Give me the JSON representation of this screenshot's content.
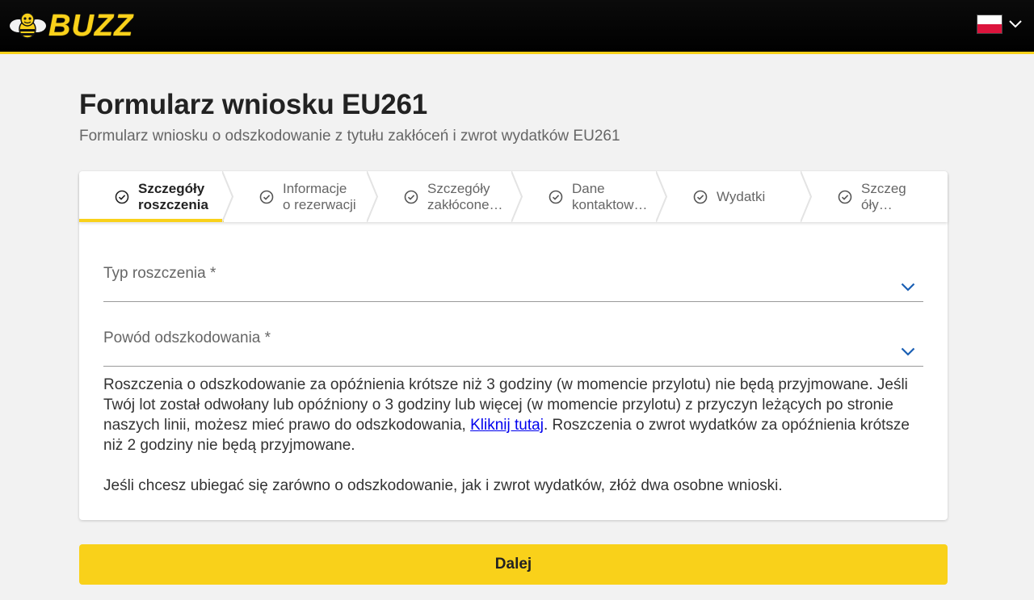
{
  "header": {
    "logo_text": "BUZZ",
    "language_flag": "poland-flag-icon",
    "brand_color": "#f9d11a"
  },
  "page": {
    "title": "Formularz wniosku EU261",
    "subtitle": "Formularz wniosku o odszkodowanie z tytułu zakłóceń i zwrot wydatków EU261"
  },
  "steps": [
    {
      "label": "Szczegóły\nroszczenia",
      "active": true
    },
    {
      "label": "Informacje\no rezerwacji",
      "active": false
    },
    {
      "label": "Szczegóły\nzakłócone…",
      "active": false
    },
    {
      "label": "Dane\nkontaktow…",
      "active": false
    },
    {
      "label": "Wydatki",
      "active": false
    },
    {
      "label": "Szczeg\nóły…",
      "active": false
    }
  ],
  "form": {
    "claim_type_label": "Typ roszczenia *",
    "compensation_reason_label": "Powód odszkodowania *"
  },
  "info": {
    "p1_before_link": "Roszczenia o odszkodowanie za opóźnienia krótsze niż 3 godziny (w momencie przylotu) nie będą przyjmowane. Jeśli Twój lot został odwołany lub opóźniony o 3 godziny lub więcej (w momencie przylotu) z przyczyn leżących po stronie naszych linii, możesz mieć prawo do odszkodowania, ",
    "link_text": "Kliknij tutaj",
    "p1_after_link": ". Roszczenia o zwrot wydatków za opóźnienia krótsze niż 2 godziny nie będą przyjmowane.",
    "p2": "Jeśli chcesz ubiegać się zarówno o odszkodowanie, jak i zwrot wydatków, złóż dwa osobne wnioski."
  },
  "actions": {
    "next_label": "Dalej"
  }
}
